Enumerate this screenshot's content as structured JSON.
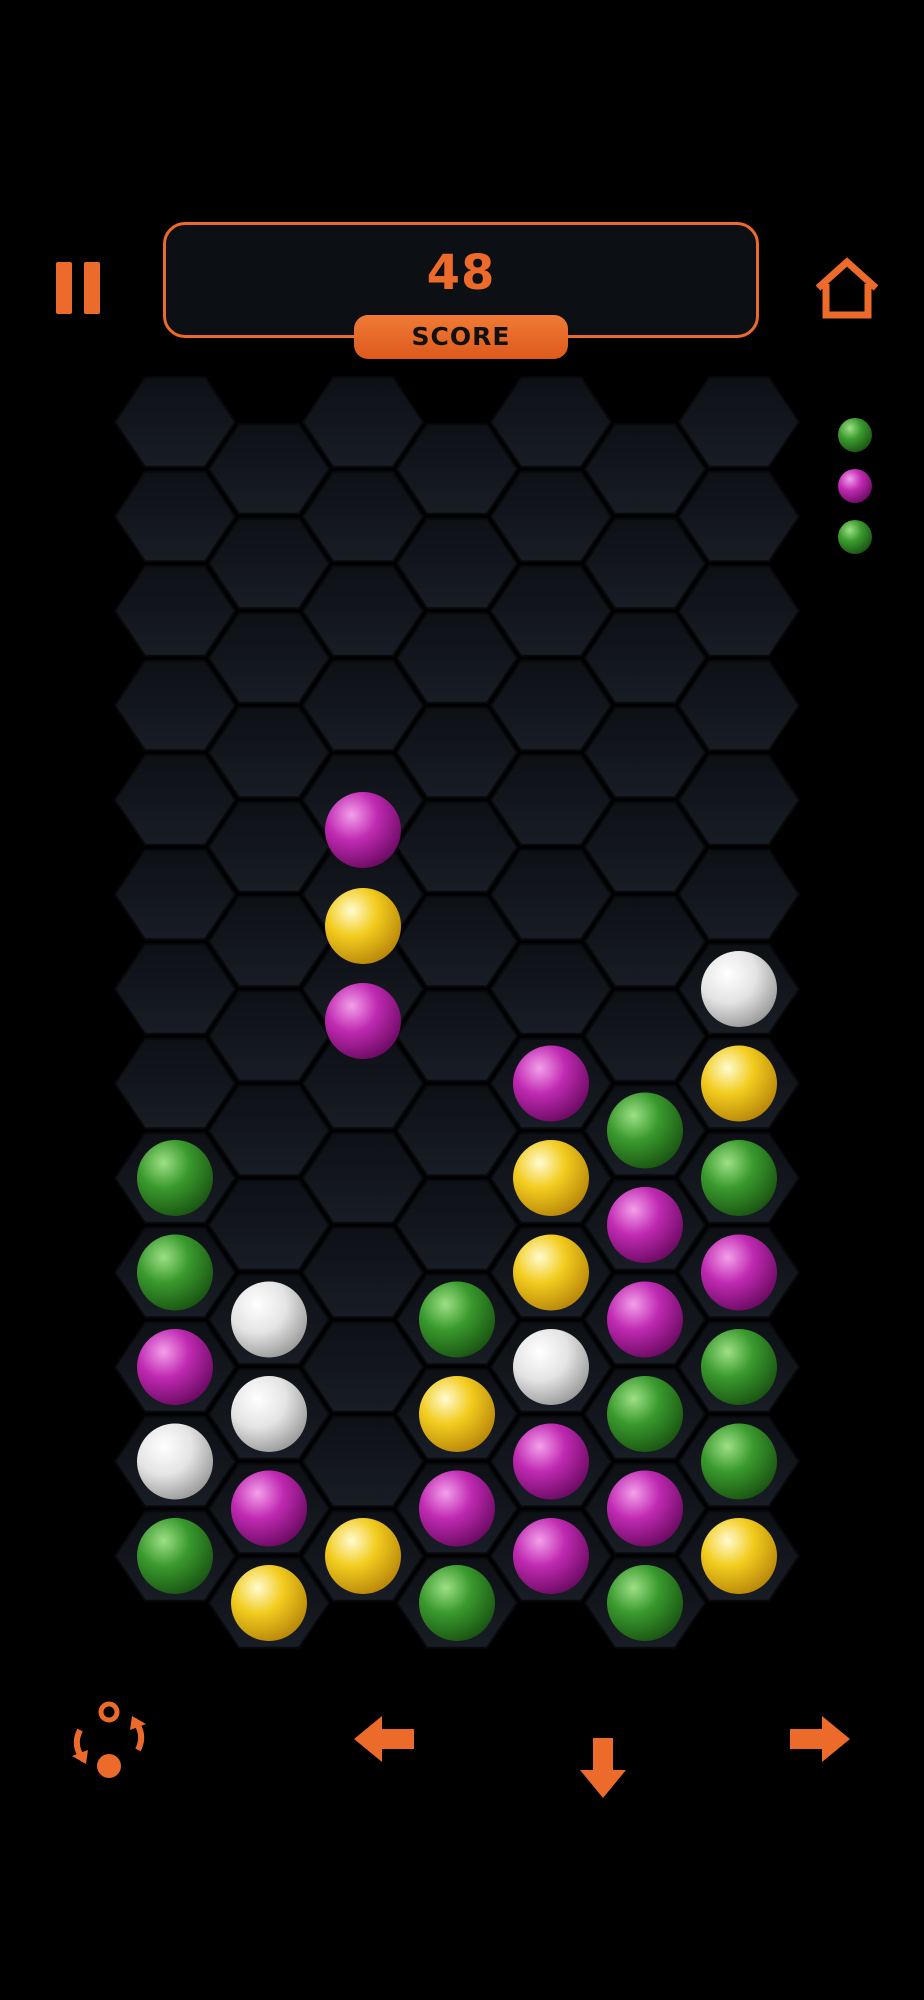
{
  "score": {
    "value": "48",
    "label": "SCORE"
  },
  "colors": {
    "accent": "#ec6a2a",
    "ball_green": "#3a9a2e",
    "ball_magenta": "#c02ab2",
    "ball_yellow": "#f2cc1e",
    "ball_white": "#e4e4e4"
  },
  "icons": {
    "pause": "pause-icon",
    "home": "home-icon",
    "rotate": "rotate-icon",
    "left": "arrow-left-icon",
    "down": "arrow-down-icon",
    "right": "arrow-right-icon"
  },
  "next_pieces": [
    "green",
    "magenta",
    "green"
  ],
  "board": {
    "columns": 7,
    "rows": 13,
    "falling_piece": {
      "column": 3,
      "balls": [
        "magenta",
        "yellow",
        "magenta"
      ]
    },
    "stacks": [
      [
        "green",
        "white",
        "magenta",
        "green",
        "green"
      ],
      [
        "yellow",
        "magenta",
        "white",
        "white"
      ],
      [
        "yellow"
      ],
      [
        "green",
        "magenta",
        "yellow",
        "green"
      ],
      [
        "magenta",
        "magenta",
        "white",
        "yellow",
        "yellow",
        "magenta"
      ],
      [
        "green",
        "magenta",
        "green",
        "magenta",
        "magenta",
        "green"
      ],
      [
        "yellow",
        "green",
        "green",
        "magenta",
        "green",
        "yellow",
        "white"
      ]
    ]
  }
}
